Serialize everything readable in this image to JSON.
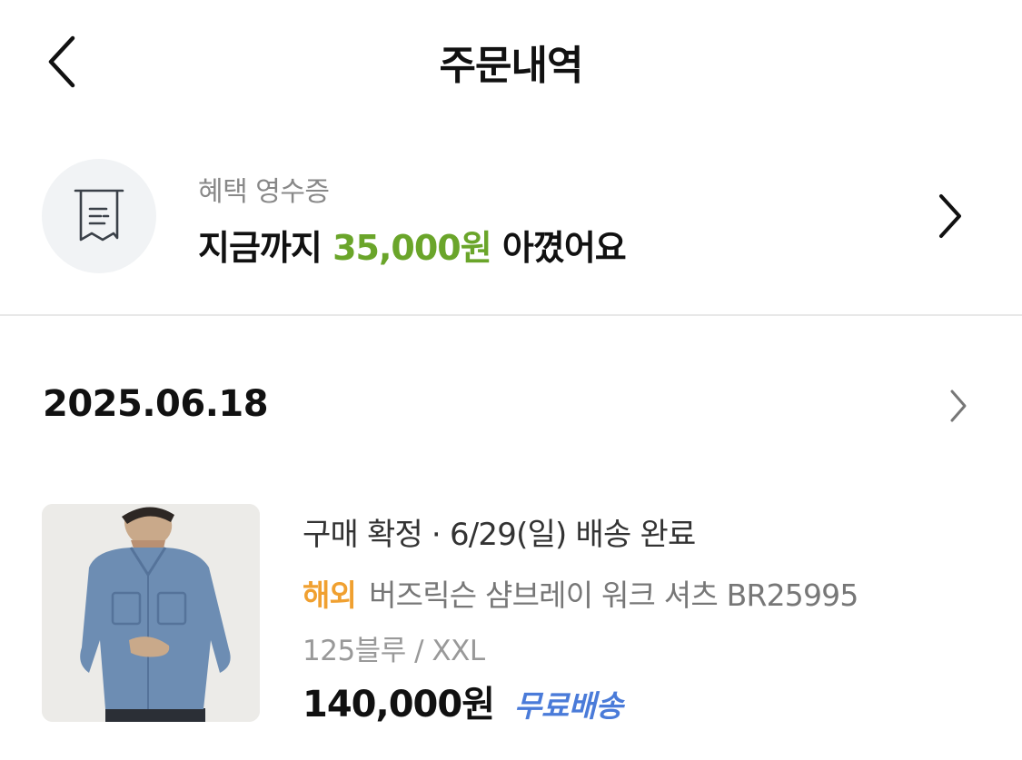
{
  "header": {
    "title": "주문내역",
    "back_icon": "chevron-left-icon"
  },
  "benefit": {
    "icon": "receipt-icon",
    "subtitle": "혜택 영수증",
    "prefix": "지금까지 ",
    "amount": "35,000원",
    "suffix": " 아꼈어요",
    "amount_color": "#6aa52a"
  },
  "orders": [
    {
      "date": "2025.06.18",
      "items": [
        {
          "image": "blue chambray work shirt worn by model",
          "status": "구매 확정 · 6/29(일) 배송 완료",
          "badge": "해외",
          "badge_color": "#f0a030",
          "name": "버즈릭슨 샴브레이 워크 셔츠 BR25995",
          "option": "125블루 / XXL",
          "price": "140,000원",
          "shipping": "무료배송",
          "shipping_color": "#4a7bd9"
        }
      ]
    }
  ]
}
